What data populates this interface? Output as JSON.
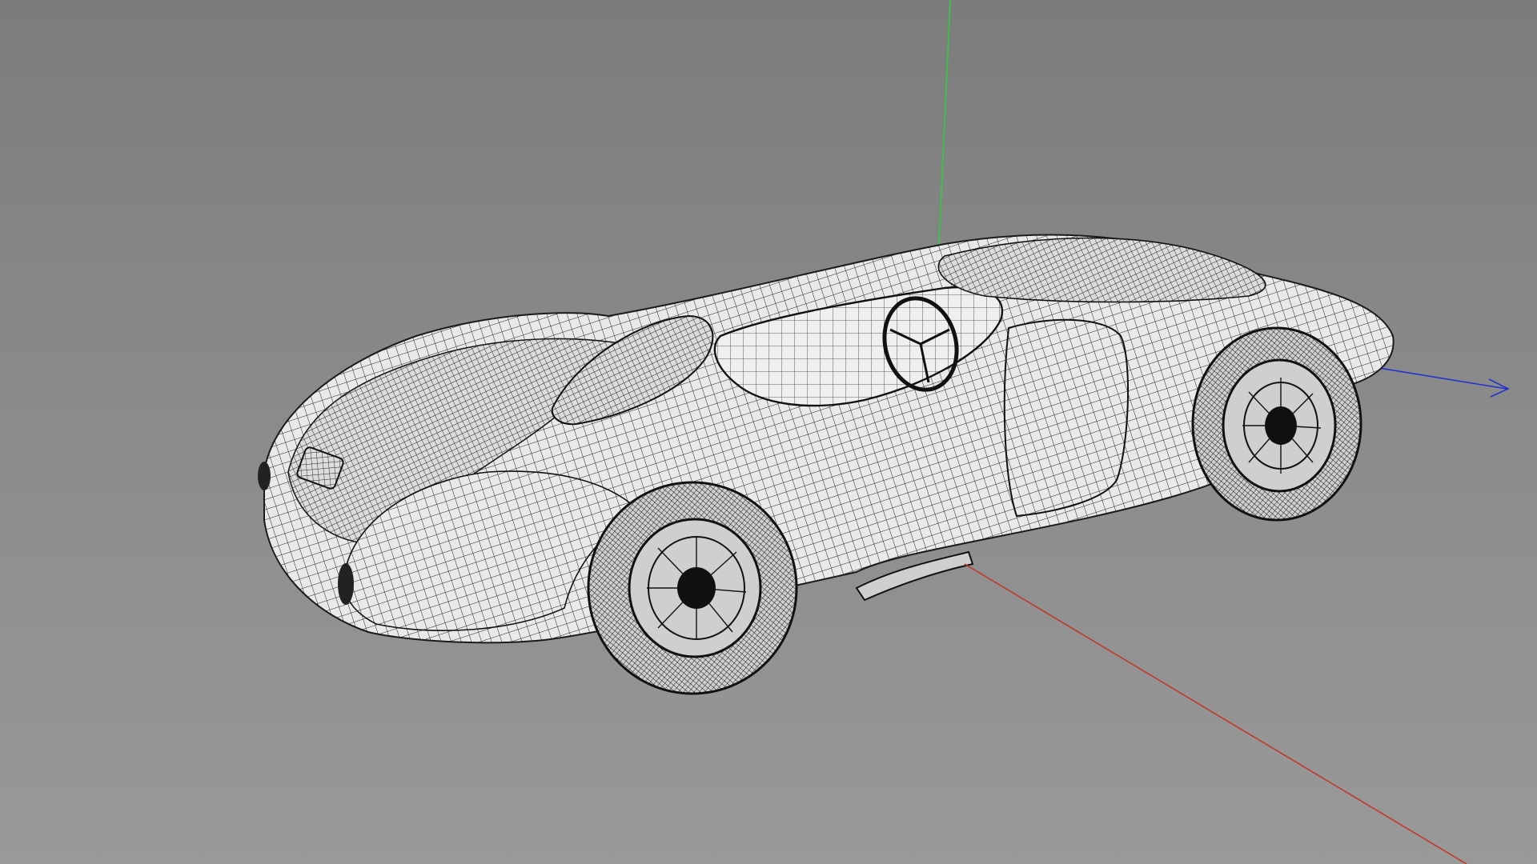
{
  "viewport": {
    "background_top": "#7c7c7c",
    "background_bottom": "#999999"
  },
  "axes": {
    "x_color": "#c0392b",
    "y_color": "#2ecc40",
    "z_color": "#2233cc"
  },
  "model": {
    "icon": "wireframe-car-icon",
    "body_color": "#e6e6e6",
    "wire_color": "#1a1a1a"
  }
}
